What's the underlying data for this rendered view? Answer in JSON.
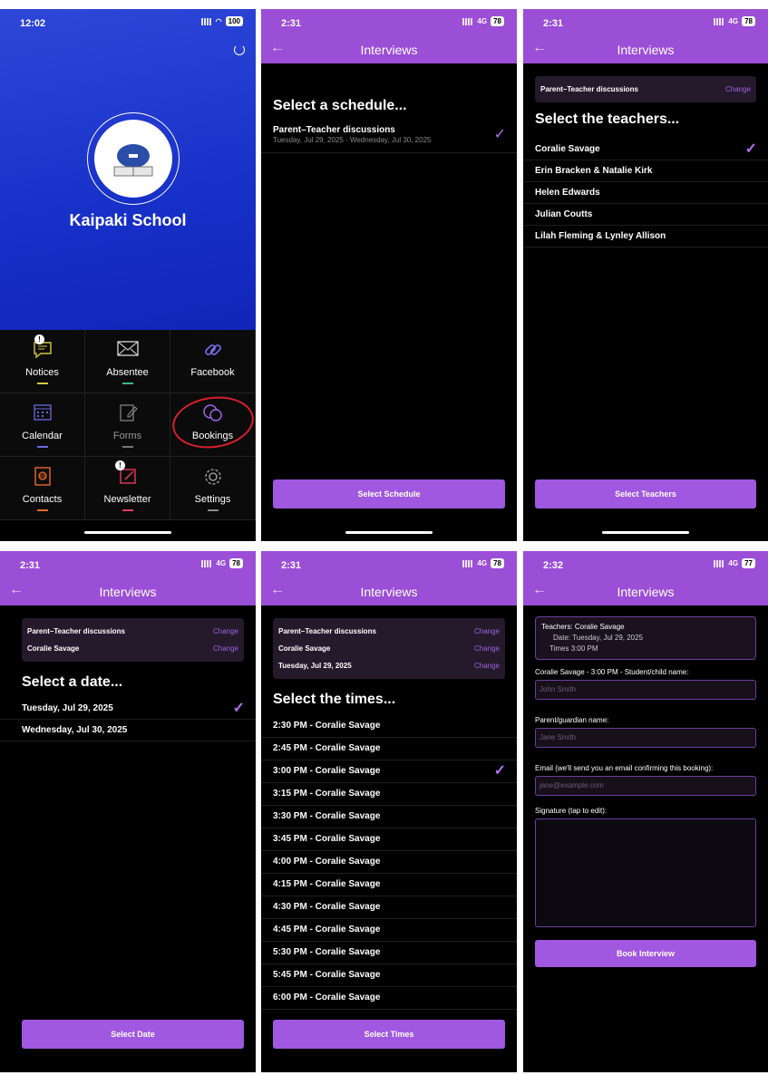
{
  "colors": {
    "accent": "#9b4ed6",
    "button": "#a058e0",
    "check": "#b070ee",
    "hero": "#2f47d8"
  },
  "home": {
    "time": "12:02",
    "battery": "100",
    "school_name": "Kaipaki School",
    "refresh_icon": "refresh-icon",
    "tiles": [
      {
        "label": "Notices",
        "icon": "chat-bubble-icon",
        "badge": "!",
        "color": "#d8c83a"
      },
      {
        "label": "Absentee",
        "icon": "envelope-icon",
        "badge": "",
        "color": "#3ab884"
      },
      {
        "label": "Facebook",
        "icon": "link-icon",
        "badge": "",
        "color": "#7a6ef0"
      },
      {
        "label": "Calendar",
        "icon": "calendar-icon",
        "badge": "",
        "color": "#6a6ae0"
      },
      {
        "label": "Forms",
        "icon": "edit-form-icon",
        "badge": "",
        "color": "#888888"
      },
      {
        "label": "Bookings",
        "icon": "bookings-bubbles-icon",
        "badge": "",
        "color": "#a060e8"
      },
      {
        "label": "Contacts",
        "icon": "contacts-book-icon",
        "badge": "",
        "color": "#e86a2a"
      },
      {
        "label": "Newsletter",
        "icon": "newsletter-icon",
        "badge": "!",
        "color": "#e83a5a"
      },
      {
        "label": "Settings",
        "icon": "gear-icon",
        "badge": "",
        "color": "#888888"
      }
    ]
  },
  "screen2": {
    "time": "2:31",
    "battery": "78",
    "network": "4G",
    "title": "Interviews",
    "heading": "Select a schedule...",
    "schedule_name": "Parent–Teacher discussions",
    "schedule_dates": "Tuesday, Jul 29, 2025 - Wednesday, Jul 30, 2025",
    "button": "Select Schedule"
  },
  "screen3": {
    "time": "2:31",
    "battery": "78",
    "network": "4G",
    "title": "Interviews",
    "summary_label": "Parent–Teacher discussions",
    "change": "Change",
    "heading": "Select the teachers...",
    "teachers": [
      "Coralie Savage",
      "Erin Bracken & Natalie Kirk",
      "Helen Edwards",
      "Julian Coutts",
      "Lilah Fleming & Lynley Allison"
    ],
    "button": "Select Teachers"
  },
  "screen4": {
    "time": "2:31",
    "battery": "78",
    "network": "4G",
    "title": "Interviews",
    "summary": [
      "Parent–Teacher discussions",
      "Coralie Savage"
    ],
    "change": "Change",
    "heading": "Select a date...",
    "dates": [
      "Tuesday, Jul 29, 2025",
      "Wednesday, Jul 30, 2025"
    ],
    "button": "Select Date"
  },
  "screen5": {
    "time": "2:31",
    "battery": "78",
    "network": "4G",
    "title": "Interviews",
    "summary": [
      "Parent–Teacher discussions",
      "Coralie Savage",
      "Tuesday, Jul 29, 2025"
    ],
    "change": "Change",
    "heading": "Select the times...",
    "times": [
      "2:30 PM - Coralie Savage",
      "2:45 PM - Coralie Savage",
      "3:00 PM - Coralie Savage",
      "3:15 PM - Coralie Savage",
      "3:30 PM - Coralie Savage",
      "3:45 PM - Coralie Savage",
      "4:00 PM - Coralie Savage",
      "4:15 PM - Coralie Savage",
      "4:30 PM - Coralie Savage",
      "4:45 PM - Coralie Savage",
      "5:30 PM - Coralie Savage",
      "5:45 PM - Coralie Savage",
      "6:00 PM - Coralie Savage"
    ],
    "button": "Select Times"
  },
  "screen6": {
    "time": "2:32",
    "battery": "77",
    "network": "4G",
    "title": "Interviews",
    "summary_teachers": "Teachers: Coralie Savage",
    "summary_date": "Date: Tuesday, Jul 29, 2025",
    "summary_times": "Times 3:00 PM",
    "student_label": "Coralie Savage - 3:00 PM - Student/child name:",
    "student_placeholder": "John Smith",
    "parent_label": "Parent/guardian name:",
    "parent_placeholder": "Jane Smith",
    "email_label": "Email (we'll send you an email confirming this booking):",
    "email_placeholder": "jane@example.com",
    "signature_label": "Signature (tap to edit):",
    "button": "Book Interview"
  }
}
